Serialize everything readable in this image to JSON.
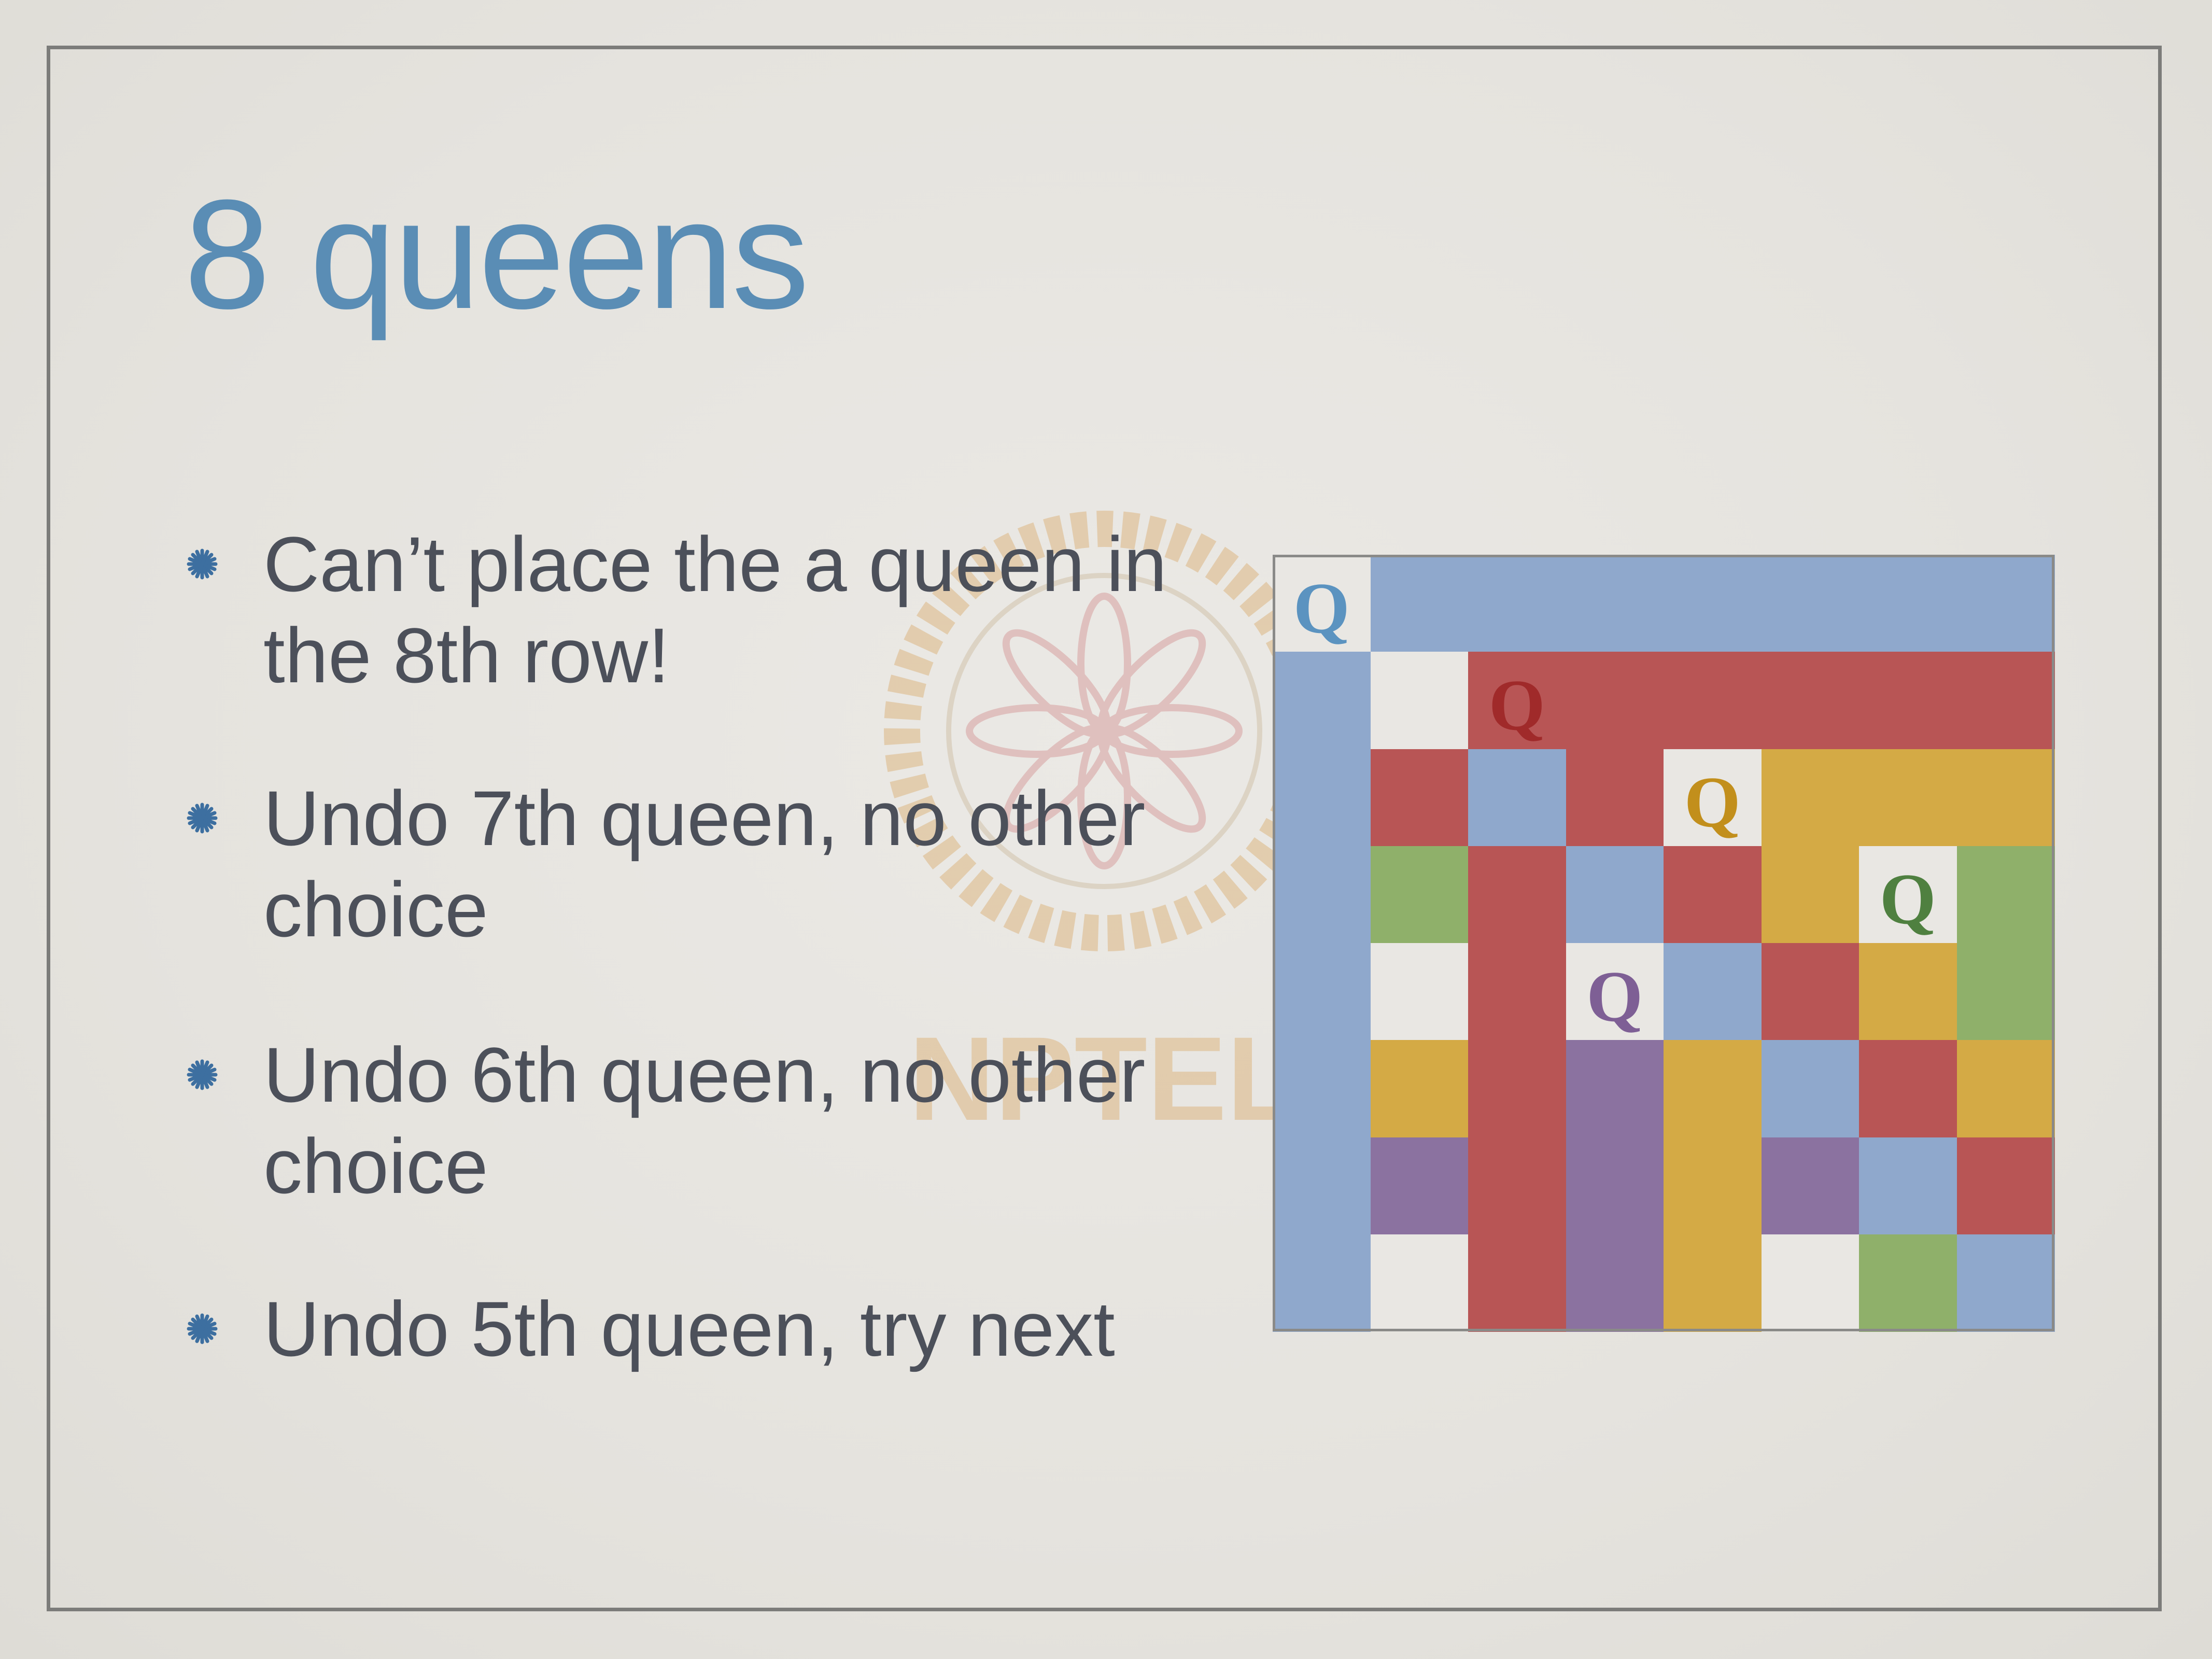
{
  "slide": {
    "title": "8 queens",
    "bullets": [
      {
        "lines": [
          "Can’t place the a queen in",
          "the 8th row!"
        ]
      },
      {
        "lines": [
          "Undo 7th queen, no other",
          "choice"
        ]
      },
      {
        "lines": [
          "Undo 6th queen, no other",
          "choice"
        ]
      },
      {
        "lines": [
          "Undo 5th queen, try next"
        ]
      }
    ],
    "watermark_text": "NPTEL",
    "colors": {
      "title": "#5a8db5",
      "text": "#4c505a",
      "bullet": "#3d6fa0",
      "frame": "#7c7c7a"
    }
  },
  "board": {
    "size": 8,
    "queen_label": "Q",
    "palette": {
      "B": "#8fa8cc",
      "R": "#b85555",
      "Y": "#d4aa45",
      "G": "#8fb06a",
      "P": "#8b72a0",
      "W": "#e9e7e3"
    },
    "grid": [
      [
        "W",
        "B",
        "B",
        "B",
        "B",
        "B",
        "B",
        "B"
      ],
      [
        "B",
        "W",
        "R",
        "R",
        "R",
        "R",
        "R",
        "R"
      ],
      [
        "B",
        "R",
        "B",
        "R",
        "W",
        "Y",
        "Y",
        "Y"
      ],
      [
        "B",
        "G",
        "R",
        "B",
        "R",
        "Y",
        "W",
        "G"
      ],
      [
        "B",
        "W",
        "R",
        "W",
        "B",
        "R",
        "Y",
        "G"
      ],
      [
        "B",
        "Y",
        "R",
        "P",
        "Y",
        "B",
        "R",
        "Y"
      ],
      [
        "B",
        "P",
        "R",
        "P",
        "Y",
        "P",
        "B",
        "R"
      ],
      [
        "B",
        "W",
        "R",
        "P",
        "Y",
        "W",
        "G",
        "B"
      ]
    ],
    "queens": [
      {
        "row": 0,
        "col": 0,
        "color": "#5b93c0"
      },
      {
        "row": 1,
        "col": 2,
        "color": "#a02a2a"
      },
      {
        "row": 2,
        "col": 4,
        "color": "#c28f1c"
      },
      {
        "row": 3,
        "col": 6,
        "color": "#4f8040"
      },
      {
        "row": 4,
        "col": 3,
        "color": "#7e5f95"
      }
    ]
  }
}
